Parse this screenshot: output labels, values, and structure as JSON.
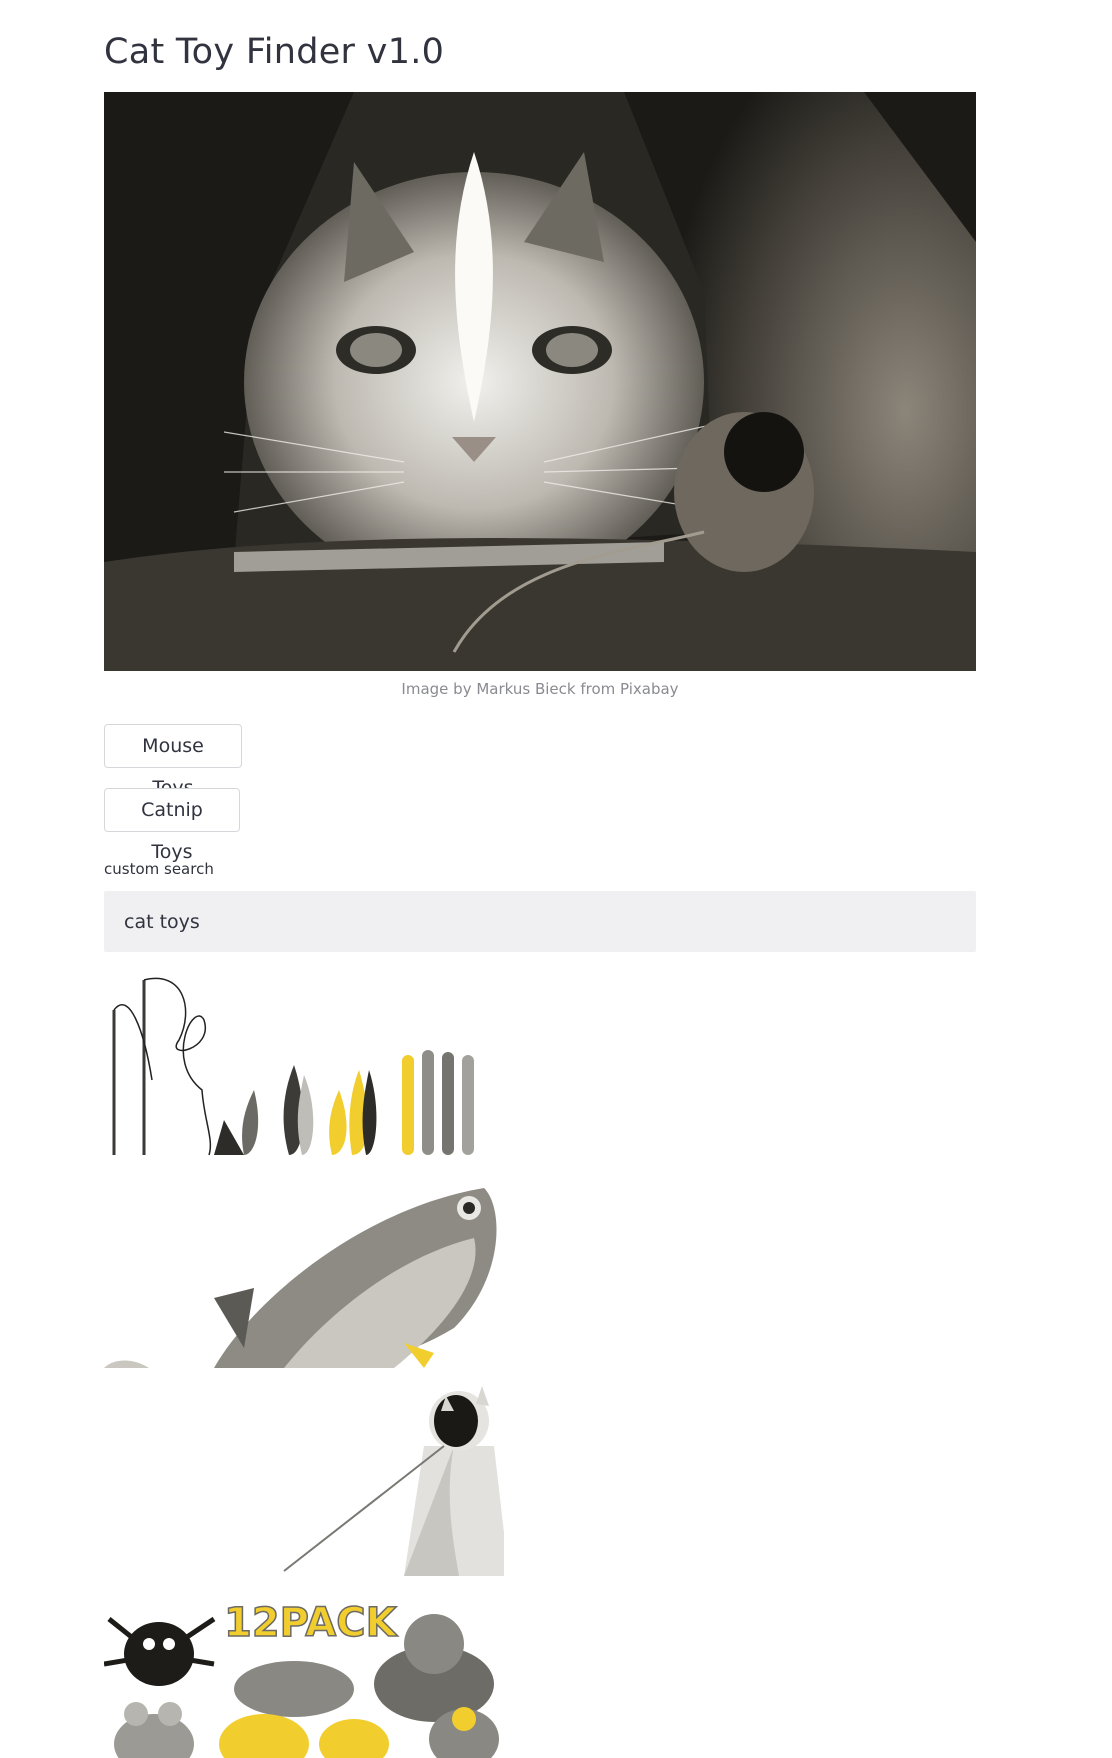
{
  "app": {
    "title": "Cat Toy Finder v1.0"
  },
  "hero": {
    "caption": "Image by Markus Bieck from Pixabay"
  },
  "buttons": {
    "mouse_toys": "Mouse Toys",
    "catnip_toys": "Catnip Toys"
  },
  "search": {
    "label": "custom search",
    "value": "cat toys"
  },
  "results": {
    "pack_label": "12PACK"
  },
  "colors": {
    "accent_yellow": "#f2cd2e",
    "text": "#31333f",
    "input_bg": "#f0f0f2",
    "caption": "#8a8b91"
  }
}
